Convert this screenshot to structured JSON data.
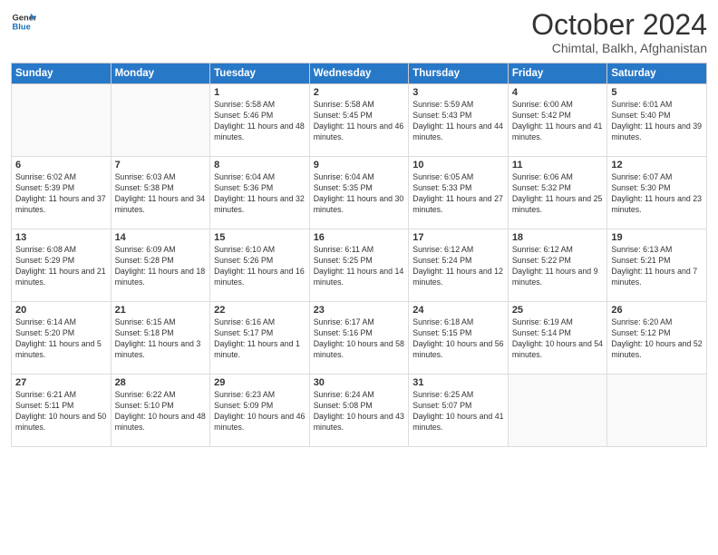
{
  "logo": {
    "line1": "General",
    "line2": "Blue"
  },
  "title": "October 2024",
  "subtitle": "Chimtal, Balkh, Afghanistan",
  "weekdays": [
    "Sunday",
    "Monday",
    "Tuesday",
    "Wednesday",
    "Thursday",
    "Friday",
    "Saturday"
  ],
  "weeks": [
    [
      {
        "day": "",
        "sunrise": "",
        "sunset": "",
        "daylight": ""
      },
      {
        "day": "",
        "sunrise": "",
        "sunset": "",
        "daylight": ""
      },
      {
        "day": "1",
        "sunrise": "Sunrise: 5:58 AM",
        "sunset": "Sunset: 5:46 PM",
        "daylight": "Daylight: 11 hours and 48 minutes."
      },
      {
        "day": "2",
        "sunrise": "Sunrise: 5:58 AM",
        "sunset": "Sunset: 5:45 PM",
        "daylight": "Daylight: 11 hours and 46 minutes."
      },
      {
        "day": "3",
        "sunrise": "Sunrise: 5:59 AM",
        "sunset": "Sunset: 5:43 PM",
        "daylight": "Daylight: 11 hours and 44 minutes."
      },
      {
        "day": "4",
        "sunrise": "Sunrise: 6:00 AM",
        "sunset": "Sunset: 5:42 PM",
        "daylight": "Daylight: 11 hours and 41 minutes."
      },
      {
        "day": "5",
        "sunrise": "Sunrise: 6:01 AM",
        "sunset": "Sunset: 5:40 PM",
        "daylight": "Daylight: 11 hours and 39 minutes."
      }
    ],
    [
      {
        "day": "6",
        "sunrise": "Sunrise: 6:02 AM",
        "sunset": "Sunset: 5:39 PM",
        "daylight": "Daylight: 11 hours and 37 minutes."
      },
      {
        "day": "7",
        "sunrise": "Sunrise: 6:03 AM",
        "sunset": "Sunset: 5:38 PM",
        "daylight": "Daylight: 11 hours and 34 minutes."
      },
      {
        "day": "8",
        "sunrise": "Sunrise: 6:04 AM",
        "sunset": "Sunset: 5:36 PM",
        "daylight": "Daylight: 11 hours and 32 minutes."
      },
      {
        "day": "9",
        "sunrise": "Sunrise: 6:04 AM",
        "sunset": "Sunset: 5:35 PM",
        "daylight": "Daylight: 11 hours and 30 minutes."
      },
      {
        "day": "10",
        "sunrise": "Sunrise: 6:05 AM",
        "sunset": "Sunset: 5:33 PM",
        "daylight": "Daylight: 11 hours and 27 minutes."
      },
      {
        "day": "11",
        "sunrise": "Sunrise: 6:06 AM",
        "sunset": "Sunset: 5:32 PM",
        "daylight": "Daylight: 11 hours and 25 minutes."
      },
      {
        "day": "12",
        "sunrise": "Sunrise: 6:07 AM",
        "sunset": "Sunset: 5:30 PM",
        "daylight": "Daylight: 11 hours and 23 minutes."
      }
    ],
    [
      {
        "day": "13",
        "sunrise": "Sunrise: 6:08 AM",
        "sunset": "Sunset: 5:29 PM",
        "daylight": "Daylight: 11 hours and 21 minutes."
      },
      {
        "day": "14",
        "sunrise": "Sunrise: 6:09 AM",
        "sunset": "Sunset: 5:28 PM",
        "daylight": "Daylight: 11 hours and 18 minutes."
      },
      {
        "day": "15",
        "sunrise": "Sunrise: 6:10 AM",
        "sunset": "Sunset: 5:26 PM",
        "daylight": "Daylight: 11 hours and 16 minutes."
      },
      {
        "day": "16",
        "sunrise": "Sunrise: 6:11 AM",
        "sunset": "Sunset: 5:25 PM",
        "daylight": "Daylight: 11 hours and 14 minutes."
      },
      {
        "day": "17",
        "sunrise": "Sunrise: 6:12 AM",
        "sunset": "Sunset: 5:24 PM",
        "daylight": "Daylight: 11 hours and 12 minutes."
      },
      {
        "day": "18",
        "sunrise": "Sunrise: 6:12 AM",
        "sunset": "Sunset: 5:22 PM",
        "daylight": "Daylight: 11 hours and 9 minutes."
      },
      {
        "day": "19",
        "sunrise": "Sunrise: 6:13 AM",
        "sunset": "Sunset: 5:21 PM",
        "daylight": "Daylight: 11 hours and 7 minutes."
      }
    ],
    [
      {
        "day": "20",
        "sunrise": "Sunrise: 6:14 AM",
        "sunset": "Sunset: 5:20 PM",
        "daylight": "Daylight: 11 hours and 5 minutes."
      },
      {
        "day": "21",
        "sunrise": "Sunrise: 6:15 AM",
        "sunset": "Sunset: 5:18 PM",
        "daylight": "Daylight: 11 hours and 3 minutes."
      },
      {
        "day": "22",
        "sunrise": "Sunrise: 6:16 AM",
        "sunset": "Sunset: 5:17 PM",
        "daylight": "Daylight: 11 hours and 1 minute."
      },
      {
        "day": "23",
        "sunrise": "Sunrise: 6:17 AM",
        "sunset": "Sunset: 5:16 PM",
        "daylight": "Daylight: 10 hours and 58 minutes."
      },
      {
        "day": "24",
        "sunrise": "Sunrise: 6:18 AM",
        "sunset": "Sunset: 5:15 PM",
        "daylight": "Daylight: 10 hours and 56 minutes."
      },
      {
        "day": "25",
        "sunrise": "Sunrise: 6:19 AM",
        "sunset": "Sunset: 5:14 PM",
        "daylight": "Daylight: 10 hours and 54 minutes."
      },
      {
        "day": "26",
        "sunrise": "Sunrise: 6:20 AM",
        "sunset": "Sunset: 5:12 PM",
        "daylight": "Daylight: 10 hours and 52 minutes."
      }
    ],
    [
      {
        "day": "27",
        "sunrise": "Sunrise: 6:21 AM",
        "sunset": "Sunset: 5:11 PM",
        "daylight": "Daylight: 10 hours and 50 minutes."
      },
      {
        "day": "28",
        "sunrise": "Sunrise: 6:22 AM",
        "sunset": "Sunset: 5:10 PM",
        "daylight": "Daylight: 10 hours and 48 minutes."
      },
      {
        "day": "29",
        "sunrise": "Sunrise: 6:23 AM",
        "sunset": "Sunset: 5:09 PM",
        "daylight": "Daylight: 10 hours and 46 minutes."
      },
      {
        "day": "30",
        "sunrise": "Sunrise: 6:24 AM",
        "sunset": "Sunset: 5:08 PM",
        "daylight": "Daylight: 10 hours and 43 minutes."
      },
      {
        "day": "31",
        "sunrise": "Sunrise: 6:25 AM",
        "sunset": "Sunset: 5:07 PM",
        "daylight": "Daylight: 10 hours and 41 minutes."
      },
      {
        "day": "",
        "sunrise": "",
        "sunset": "",
        "daylight": ""
      },
      {
        "day": "",
        "sunrise": "",
        "sunset": "",
        "daylight": ""
      }
    ]
  ]
}
